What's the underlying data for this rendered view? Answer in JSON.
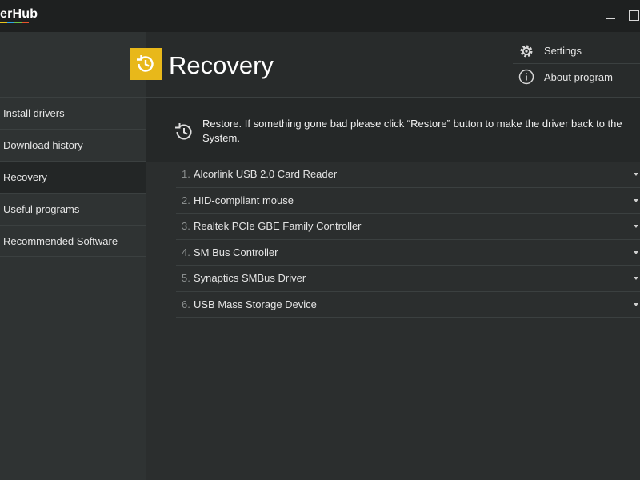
{
  "app": {
    "logo_text": "erHub"
  },
  "window": {
    "minimize_icon": "minimize-icon",
    "maximize_icon": "maximize-icon"
  },
  "sidebar": {
    "items": [
      {
        "label": "Install drivers"
      },
      {
        "label": "Download history"
      },
      {
        "label": "Recovery",
        "active": true
      },
      {
        "label": "Useful programs"
      },
      {
        "label": "Recommended Software"
      }
    ]
  },
  "header": {
    "title": "Recovery",
    "title_icon": "restore-clock-icon",
    "accent_color": "#e8b81a",
    "links": [
      {
        "label": "Settings",
        "icon": "gear-icon"
      },
      {
        "label": "About program",
        "icon": "info-icon"
      }
    ]
  },
  "info": {
    "icon": "restore-clock-icon",
    "text": "Restore. If something gone bad please click “Restore” button to make the driver back to the System."
  },
  "devices": [
    {
      "index": "1.",
      "name": "Alcorlink USB 2.0 Card Reader"
    },
    {
      "index": "2.",
      "name": "HID-compliant mouse"
    },
    {
      "index": "3.",
      "name": "Realtek PCIe GBE Family Controller"
    },
    {
      "index": "4.",
      "name": "SM Bus Controller"
    },
    {
      "index": "5.",
      "name": "Synaptics SMBus Driver"
    },
    {
      "index": "6.",
      "name": "USB Mass Storage Device"
    }
  ]
}
